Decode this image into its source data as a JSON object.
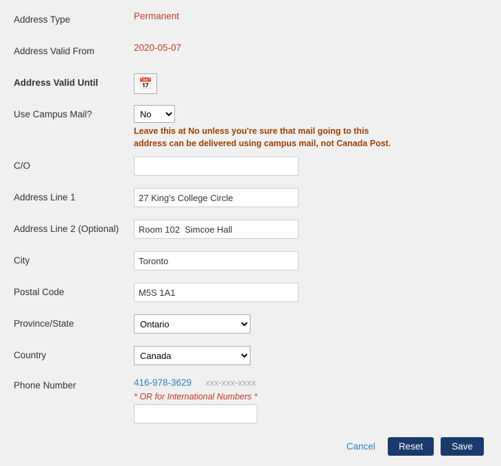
{
  "form": {
    "address_type_label": "Address Type",
    "address_type_value": "Permanent",
    "address_valid_from_label": "Address Valid From",
    "address_valid_from_value": "2020-05-07",
    "address_valid_until_label": "Address Valid Until",
    "address_valid_until_value": "",
    "use_campus_mail_label": "Use Campus Mail?",
    "campus_mail_no_option": "No",
    "campus_mail_note": "Leave this at No unless you're sure that mail going to this address can be delivered using campus mail, not Canada Post.",
    "co_label": "C/O",
    "co_value": "",
    "address_line1_label": "Address Line 1",
    "address_line1_value": "27 King's College Circle",
    "address_line2_label": "Address Line 2 (Optional)",
    "address_line2_value": "Room 102  Simcoe Hall",
    "city_label": "City",
    "city_value": "Toronto",
    "postal_code_label": "Postal Code",
    "postal_code_value": "M5S 1A1",
    "province_state_label": "Province/State",
    "province_state_value": "Ontario",
    "country_label": "Country",
    "country_value": "Canada",
    "phone_number_label": "Phone Number",
    "phone_number_value": "416-978-3629",
    "phone_placeholder": "xxx-xxx-xxxx",
    "phone_or_text": "* OR for International Numbers *",
    "cancel_label": "Cancel",
    "reset_label": "Reset",
    "save_label": "Save",
    "calendar_icon": "📅"
  }
}
